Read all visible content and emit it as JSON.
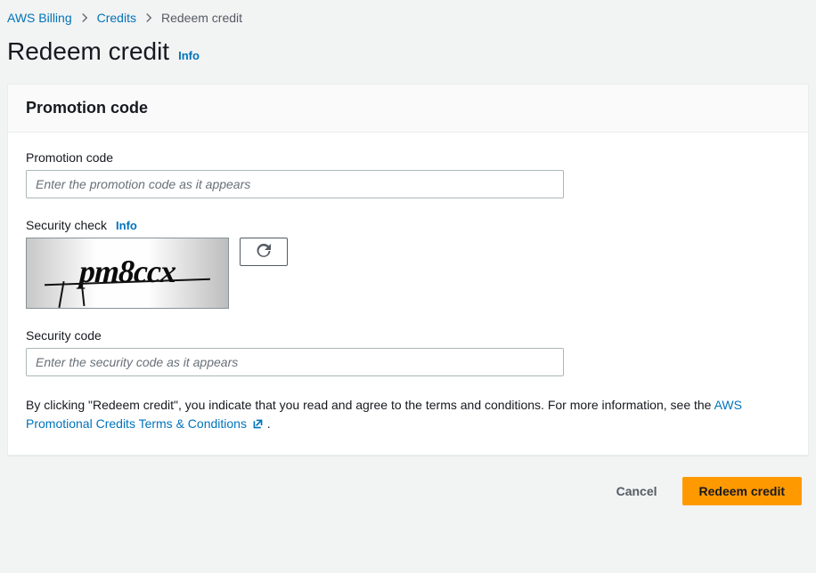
{
  "breadcrumb": {
    "items": [
      {
        "label": "AWS Billing"
      },
      {
        "label": "Credits"
      }
    ],
    "current": "Redeem credit"
  },
  "header": {
    "title": "Redeem credit",
    "info": "Info"
  },
  "panel": {
    "title": "Promotion code",
    "promo": {
      "label": "Promotion code",
      "placeholder": "Enter the promotion code as it appears",
      "value": ""
    },
    "security_check": {
      "label": "Security check",
      "info": "Info",
      "captcha_text": "pm8ccx"
    },
    "security_code": {
      "label": "Security code",
      "placeholder": "Enter the security code as it appears",
      "value": ""
    },
    "disclosure": {
      "prefix": "By clicking \"Redeem credit\", you indicate that you read and agree to the terms and conditions. For more information, see the ",
      "link": "AWS Promotional Credits Terms & Conditions",
      "suffix": "."
    }
  },
  "actions": {
    "cancel": "Cancel",
    "redeem": "Redeem credit"
  }
}
